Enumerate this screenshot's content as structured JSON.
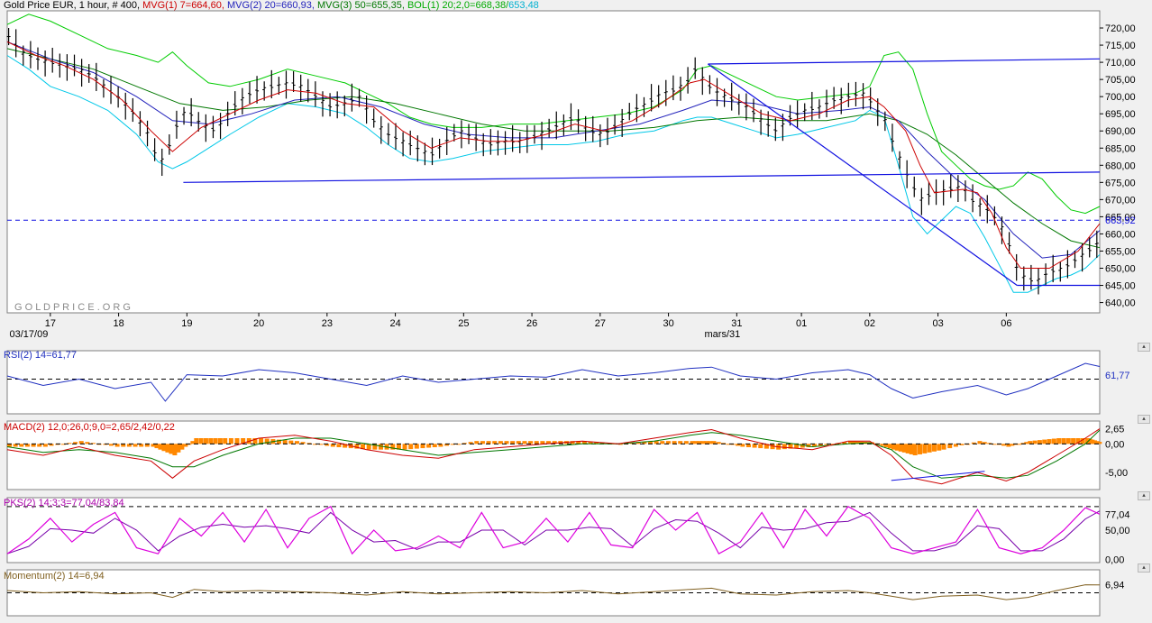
{
  "header": {
    "title": "Gold Price EUR",
    "interval": ", 1 hour, # 400,",
    "mvg1": "MVG(1) 7=664,60,",
    "mvg2": "MVG(2) 20=660,93,",
    "mvg3": "MVG(3) 50=655,35,",
    "bol": "BOL(1) 20;2,0=668,38/",
    "bol_lower": "653,48"
  },
  "watermark": "GOLDPRICE.ORG",
  "colors": {
    "mvg1": "#cc0000",
    "mvg2": "#2222bb",
    "mvg3": "#007700",
    "bol_upper": "#00cc00",
    "bol_lower": "#00c8e8",
    "bars": "#000000",
    "trend": "#1010e0",
    "rsi": "#2030c0",
    "macd": "#cc0000",
    "macd_signal": "#007700",
    "macd_hist": "#ff8800",
    "stoch_k": "#dd00dd",
    "stoch_d": "#7700aa",
    "momentum": "#806020"
  },
  "icons": [
    "scroll-button-icon"
  ],
  "panels": {
    "rsi": {
      "label": "RSI(2) 14=61,77",
      "value": "61,77"
    },
    "macd": {
      "label": "MACD(2) 12,0;26,0;9,0=2,65/2,42/0,22",
      "ticks": [
        "2,65",
        "0,00",
        "-5,00"
      ]
    },
    "stoch": {
      "label": "PKS(2) 14;3;3=77,04/83,84",
      "ticks": [
        "77,04",
        "50,00",
        "0,00"
      ]
    },
    "momentum": {
      "label": "Momentum(2) 14=6,94",
      "value": "6,94"
    }
  },
  "chart_data": {
    "type": "line",
    "title": "Gold Price EUR",
    "ylim": [
      637,
      725
    ],
    "y_ticks": [
      "720,00",
      "715,00",
      "710,00",
      "705,00",
      "700,00",
      "695,00",
      "690,00",
      "685,00",
      "680,00",
      "675,00",
      "670,00",
      "665,00",
      "660,00",
      "655,00",
      "650,00",
      "645,00",
      "640,00"
    ],
    "current_value_label": "663,92",
    "x_ticks": [
      {
        "label": "17",
        "i": 0.6
      },
      {
        "label": "18",
        "i": 1.55
      },
      {
        "label": "19",
        "i": 2.5
      },
      {
        "label": "20",
        "i": 3.5
      },
      {
        "label": "23",
        "i": 4.45
      },
      {
        "label": "24",
        "i": 5.4
      },
      {
        "label": "25",
        "i": 6.35
      },
      {
        "label": "26",
        "i": 7.3
      },
      {
        "label": "27",
        "i": 8.25
      },
      {
        "label": "30",
        "i": 9.2
      },
      {
        "label": "31",
        "i": 10.15
      },
      {
        "label": "01",
        "i": 11.05
      },
      {
        "label": "02",
        "i": 12.0
      },
      {
        "label": "03",
        "i": 12.95
      },
      {
        "label": "06",
        "i": 13.9
      }
    ],
    "x_sublabels": [
      {
        "label": "03/17/09",
        "i": 0.3
      },
      {
        "label": "mars/31",
        "i": 9.95
      }
    ],
    "x_range": [
      0,
      15.2
    ],
    "price_series": {
      "name": "Gold Price EUR",
      "x": [
        0,
        0.2,
        0.4,
        0.6,
        0.8,
        1.0,
        1.2,
        1.4,
        1.6,
        1.8,
        2.0,
        2.1,
        2.2,
        2.3,
        2.4,
        2.5,
        2.7,
        2.9,
        3.1,
        3.3,
        3.5,
        3.7,
        3.9,
        4.1,
        4.3,
        4.5,
        4.7,
        4.9,
        5.1,
        5.3,
        5.5,
        5.7,
        5.9,
        6.1,
        6.3,
        6.5,
        6.7,
        6.9,
        7.1,
        7.3,
        7.5,
        7.7,
        7.9,
        8.1,
        8.3,
        8.5,
        8.7,
        8.9,
        9.1,
        9.3,
        9.5,
        9.6,
        9.7,
        9.9,
        10.1,
        10.3,
        10.5,
        10.7,
        10.9,
        11.1,
        11.3,
        11.5,
        11.7,
        11.9,
        12.0,
        12.1,
        12.2,
        12.3,
        12.5,
        12.7,
        12.9,
        13.1,
        13.3,
        13.4,
        13.5,
        13.7,
        13.9,
        14.0,
        14.1,
        14.3,
        14.5,
        14.7,
        14.9,
        15.1,
        15.2
      ],
      "y": [
        718,
        713,
        711,
        710,
        709,
        708,
        706,
        702,
        699,
        694,
        688,
        680,
        683,
        688,
        694,
        696,
        692,
        690,
        696,
        700,
        702,
        703,
        704,
        703,
        700,
        697,
        698,
        700,
        693,
        689,
        687,
        685,
        683,
        687,
        690,
        688,
        686,
        687,
        687,
        688,
        690,
        692,
        694,
        690,
        689,
        692,
        696,
        698,
        701,
        702,
        705,
        709,
        704,
        701,
        699,
        697,
        693,
        690,
        694,
        696,
        697,
        699,
        700,
        701,
        699,
        696,
        694,
        688,
        678,
        670,
        672,
        673,
        674,
        670,
        669,
        666,
        660,
        652,
        648,
        646,
        649,
        650,
        653,
        656,
        658,
        660,
        663,
        664,
        664
      ]
    },
    "mvg1_series": {
      "name": "MVG(1) 7",
      "x": [
        0,
        0.4,
        0.8,
        1.2,
        1.6,
        2.0,
        2.3,
        2.7,
        3.1,
        3.5,
        3.9,
        4.3,
        4.7,
        5.1,
        5.5,
        5.9,
        6.3,
        6.7,
        7.1,
        7.5,
        7.9,
        8.3,
        8.7,
        9.1,
        9.5,
        9.7,
        10.1,
        10.5,
        10.9,
        11.3,
        11.7,
        12.0,
        12.2,
        12.5,
        12.7,
        12.9,
        13.3,
        13.5,
        13.7,
        13.9,
        14.1,
        14.5,
        14.9,
        15.2
      ],
      "y": [
        716,
        712,
        709,
        705,
        699,
        690,
        684,
        691,
        695,
        699,
        702,
        701,
        698,
        697,
        690,
        685,
        688,
        687,
        687,
        689,
        692,
        690,
        693,
        698,
        704,
        705,
        700,
        695,
        693,
        695,
        699,
        700,
        697,
        690,
        680,
        672,
        673,
        672,
        666,
        656,
        650,
        650,
        655,
        663
      ]
    },
    "mvg2_series": {
      "name": "MVG(2) 20",
      "x": [
        0,
        0.6,
        1.2,
        1.8,
        2.3,
        2.8,
        3.4,
        4.0,
        4.6,
        5.2,
        5.8,
        6.4,
        7.0,
        7.6,
        8.2,
        8.8,
        9.4,
        9.8,
        10.4,
        11.0,
        11.6,
        12.0,
        12.4,
        12.8,
        13.2,
        13.6,
        14.0,
        14.4,
        14.8,
        15.2
      ],
      "y": [
        716,
        711,
        707,
        700,
        693,
        692,
        695,
        699,
        700,
        697,
        692,
        689,
        688,
        688,
        690,
        692,
        696,
        699,
        698,
        695,
        696,
        697,
        693,
        684,
        676,
        670,
        660,
        653,
        654,
        661
      ]
    },
    "mvg3_series": {
      "name": "MVG(3) 50",
      "x": [
        0,
        0.6,
        1.2,
        1.8,
        2.4,
        3.0,
        3.6,
        4.2,
        4.8,
        5.4,
        6.0,
        6.6,
        7.2,
        7.8,
        8.4,
        9.0,
        9.6,
        10.2,
        10.8,
        11.4,
        12.0,
        12.4,
        12.8,
        13.2,
        13.6,
        14.0,
        14.4,
        14.8,
        15.2
      ],
      "y": [
        714,
        711,
        708,
        703,
        698,
        696,
        697,
        699,
        700,
        698,
        695,
        692,
        690,
        690,
        690,
        691,
        693,
        694,
        693,
        693,
        695,
        693,
        689,
        683,
        676,
        669,
        663,
        658,
        656
      ]
    },
    "bol_upper_series": {
      "name": "BOL(1) 20 upper",
      "x": [
        0,
        0.3,
        0.6,
        1.0,
        1.4,
        1.8,
        2.1,
        2.3,
        2.5,
        2.8,
        3.1,
        3.5,
        3.9,
        4.3,
        4.7,
        5.0,
        5.3,
        5.6,
        5.9,
        6.2,
        6.6,
        7.0,
        7.4,
        7.8,
        8.2,
        8.6,
        9.0,
        9.4,
        9.6,
        9.8,
        10.1,
        10.4,
        10.7,
        11.0,
        11.4,
        11.8,
        12.0,
        12.2,
        12.4,
        12.6,
        12.8,
        13.0,
        13.2,
        13.4,
        13.6,
        13.8,
        14.0,
        14.2,
        14.4,
        14.6,
        14.8,
        15.0,
        15.2
      ],
      "y": [
        721,
        724,
        722,
        718,
        714,
        712,
        710,
        713,
        709,
        704,
        703,
        705,
        708,
        706,
        704,
        701,
        698,
        694,
        692,
        691,
        691,
        692,
        692,
        693,
        694,
        695,
        697,
        702,
        708,
        709,
        706,
        703,
        700,
        699,
        700,
        701,
        703,
        712,
        713,
        708,
        695,
        684,
        680,
        676,
        674,
        673,
        674,
        678,
        676,
        671,
        667,
        666,
        668
      ]
    },
    "bol_lower_series": {
      "name": "BOL(1) 20 lower",
      "x": [
        0,
        0.3,
        0.6,
        1.0,
        1.4,
        1.8,
        2.1,
        2.3,
        2.5,
        2.8,
        3.1,
        3.5,
        3.9,
        4.3,
        4.7,
        5.0,
        5.3,
        5.6,
        5.9,
        6.2,
        6.6,
        7.0,
        7.4,
        7.8,
        8.2,
        8.6,
        9.0,
        9.4,
        9.6,
        9.8,
        10.1,
        10.4,
        10.7,
        11.0,
        11.4,
        11.8,
        12.0,
        12.2,
        12.4,
        12.6,
        12.8,
        13.0,
        13.2,
        13.4,
        13.6,
        13.8,
        14.0,
        14.2,
        14.4,
        14.6,
        14.8,
        15.0,
        15.2
      ],
      "y": [
        712,
        708,
        703,
        700,
        696,
        689,
        681,
        679,
        681,
        685,
        689,
        694,
        698,
        697,
        695,
        691,
        686,
        682,
        681,
        682,
        684,
        685,
        686,
        686,
        687,
        689,
        690,
        693,
        694,
        694,
        692,
        690,
        688,
        689,
        691,
        693,
        696,
        694,
        680,
        665,
        660,
        664,
        668,
        666,
        659,
        651,
        643,
        643,
        645,
        647,
        648,
        650,
        654
      ]
    },
    "dashed_level": 664,
    "trendlines": [
      {
        "x": [
          2.45,
          15.2
        ],
        "y": [
          675,
          678
        ]
      },
      {
        "x": [
          9.75,
          15.2
        ],
        "y": [
          709.5,
          711
        ]
      },
      {
        "x": [
          9.75,
          14.05
        ],
        "y": [
          709.5,
          645
        ]
      },
      {
        "x": [
          14.05,
          15.2
        ],
        "y": [
          645,
          645
        ]
      }
    ],
    "rsi": {
      "ylim": [
        0,
        100
      ],
      "reference": 55,
      "last": 61.77,
      "x": [
        0,
        0.5,
        1.0,
        1.5,
        2.0,
        2.2,
        2.5,
        3.0,
        3.5,
        4.0,
        4.5,
        5.0,
        5.5,
        6.0,
        6.5,
        7.0,
        7.5,
        8.0,
        8.5,
        9.0,
        9.5,
        9.8,
        10.2,
        10.7,
        11.2,
        11.7,
        12.0,
        12.3,
        12.6,
        13.0,
        13.5,
        13.9,
        14.2,
        14.6,
        15.0,
        15.2
      ],
      "y": [
        60,
        45,
        55,
        40,
        50,
        20,
        62,
        60,
        70,
        65,
        55,
        45,
        60,
        50,
        55,
        60,
        58,
        70,
        60,
        65,
        72,
        74,
        60,
        55,
        65,
        70,
        62,
        40,
        25,
        35,
        45,
        30,
        40,
        60,
        80,
        75
      ]
    },
    "macd": {
      "ylim": [
        -8,
        4
      ],
      "last_macd": 2.65,
      "last_signal": 2.42,
      "last_hist": 0.22,
      "x": [
        0,
        0.5,
        1.0,
        1.5,
        2.0,
        2.3,
        2.6,
        3.0,
        3.5,
        4.0,
        4.5,
        5.0,
        5.5,
        6.0,
        6.5,
        7.0,
        7.5,
        8.0,
        8.5,
        9.0,
        9.5,
        9.8,
        10.2,
        10.7,
        11.2,
        11.7,
        12.0,
        12.3,
        12.6,
        13.0,
        13.5,
        13.9,
        14.2,
        14.6,
        15.0,
        15.2
      ],
      "macd_y": [
        -1,
        -2,
        -0.5,
        -2,
        -3,
        -6,
        -3,
        -1,
        1,
        1.5,
        0.5,
        -1,
        -2,
        -2.5,
        -1,
        -0.5,
        0,
        0.5,
        0,
        1,
        2,
        2.5,
        1,
        -0.5,
        -1,
        0.5,
        0.5,
        -2,
        -6,
        -7,
        -5,
        -6.5,
        -5,
        -2,
        1,
        2.65
      ],
      "signal_y": [
        -0.5,
        -1.5,
        -1,
        -1.5,
        -2.5,
        -4,
        -4,
        -2,
        0,
        1,
        1,
        0,
        -1,
        -2,
        -1.5,
        -1,
        -0.5,
        0,
        0,
        0.5,
        1.5,
        2,
        1.5,
        0.5,
        -0.5,
        0,
        0.2,
        -1,
        -4,
        -6,
        -5.5,
        -6,
        -5.5,
        -3,
        0,
        2.42
      ]
    },
    "stoch": {
      "ylim": [
        -5,
        105
      ],
      "upper_ref": 90,
      "k_last": 77.04,
      "d_last": 83.84,
      "x": [
        0,
        0.3,
        0.6,
        0.9,
        1.2,
        1.5,
        1.8,
        2.1,
        2.4,
        2.7,
        3.0,
        3.3,
        3.6,
        3.9,
        4.2,
        4.5,
        4.8,
        5.1,
        5.4,
        5.7,
        6.0,
        6.3,
        6.6,
        6.9,
        7.2,
        7.5,
        7.8,
        8.1,
        8.4,
        8.7,
        9.0,
        9.3,
        9.6,
        9.9,
        10.2,
        10.5,
        10.8,
        11.1,
        11.4,
        11.7,
        12.0,
        12.3,
        12.6,
        12.9,
        13.2,
        13.5,
        13.8,
        14.1,
        14.4,
        14.7,
        15.0,
        15.2
      ],
      "k_y": [
        10,
        35,
        70,
        30,
        60,
        80,
        20,
        10,
        70,
        40,
        80,
        30,
        85,
        20,
        70,
        90,
        10,
        50,
        15,
        20,
        40,
        20,
        80,
        20,
        30,
        70,
        30,
        80,
        25,
        20,
        85,
        50,
        80,
        10,
        30,
        80,
        20,
        85,
        40,
        90,
        70,
        20,
        10,
        20,
        30,
        85,
        20,
        10,
        20,
        50,
        88,
        77
      ]
    },
    "momentum": {
      "ylim": [
        -20,
        20
      ],
      "reference": 0,
      "last": 6.94,
      "x": [
        0,
        0.5,
        1.0,
        1.5,
        2.0,
        2.3,
        2.6,
        3.0,
        3.5,
        4.0,
        4.5,
        5.0,
        5.5,
        6.0,
        6.5,
        7.0,
        7.5,
        8.0,
        8.5,
        9.0,
        9.5,
        9.8,
        10.2,
        10.7,
        11.2,
        11.7,
        12.0,
        12.3,
        12.6,
        13.0,
        13.5,
        13.9,
        14.2,
        14.6,
        15.0,
        15.2
      ],
      "y": [
        2,
        0,
        1,
        -1,
        0,
        -4,
        3,
        1,
        2,
        1,
        0,
        -2,
        1,
        -1,
        0,
        1,
        0,
        2,
        -1,
        1,
        3,
        4,
        -1,
        -2,
        1,
        2,
        0,
        -3,
        -6,
        -3,
        -2,
        -6,
        -4,
        2,
        7,
        6.94
      ]
    }
  }
}
